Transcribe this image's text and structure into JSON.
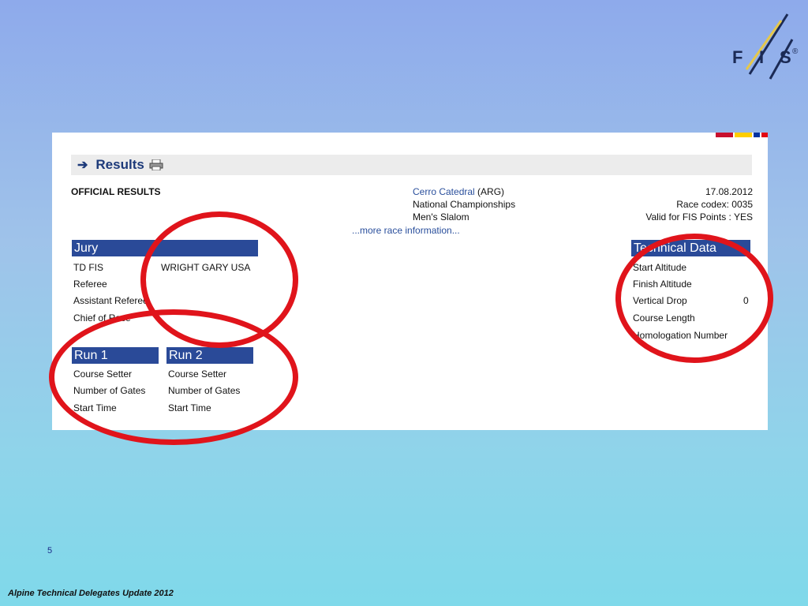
{
  "logo": {
    "letters": [
      "F",
      "I",
      "S"
    ],
    "registered": "®"
  },
  "colors": {
    "accent_red": "#e0141b",
    "header_blue": "#2a4a98",
    "link_blue": "#2a4f9c"
  },
  "results": {
    "title": "Results",
    "arrow_icon": "right-arrow-icon",
    "printer_icon": "printer-icon"
  },
  "official": {
    "label": "OFFICIAL RESULTS"
  },
  "race": {
    "location": "Cerro Catedral",
    "nation": "(ARG)",
    "event": "National Championships",
    "discipline": "Men's Slalom",
    "more_link": "...more race information..."
  },
  "meta": {
    "date": "17.08.2012",
    "codex": "Race codex: 0035",
    "fis_points": "Valid for FIS Points : YES"
  },
  "jury": {
    "header": "Jury",
    "rows": [
      {
        "label": "TD FIS",
        "value": "WRIGHT GARY  USA"
      },
      {
        "label": "Referee",
        "value": ""
      },
      {
        "label": "Assistant Referee",
        "value": ""
      },
      {
        "label": "Chief of Race",
        "value": ""
      }
    ]
  },
  "run1": {
    "header": "Run 1",
    "rows": [
      "Course Setter",
      "Number of Gates",
      "Start Time"
    ]
  },
  "run2": {
    "header": "Run 2",
    "rows": [
      "Course Setter",
      "Number of Gates",
      "Start Time"
    ]
  },
  "technical": {
    "header": "Technical Data",
    "rows": [
      {
        "label": "Start Altitude",
        "value": ""
      },
      {
        "label": "Finish Altitude",
        "value": ""
      },
      {
        "label": "Vertical Drop",
        "value": "0"
      },
      {
        "label": "Course Length",
        "value": ""
      },
      {
        "label": "Homologation Number",
        "value": ""
      }
    ]
  },
  "slide": {
    "page_number": "5",
    "footer": "Alpine Technical Delegates Update 2012"
  }
}
